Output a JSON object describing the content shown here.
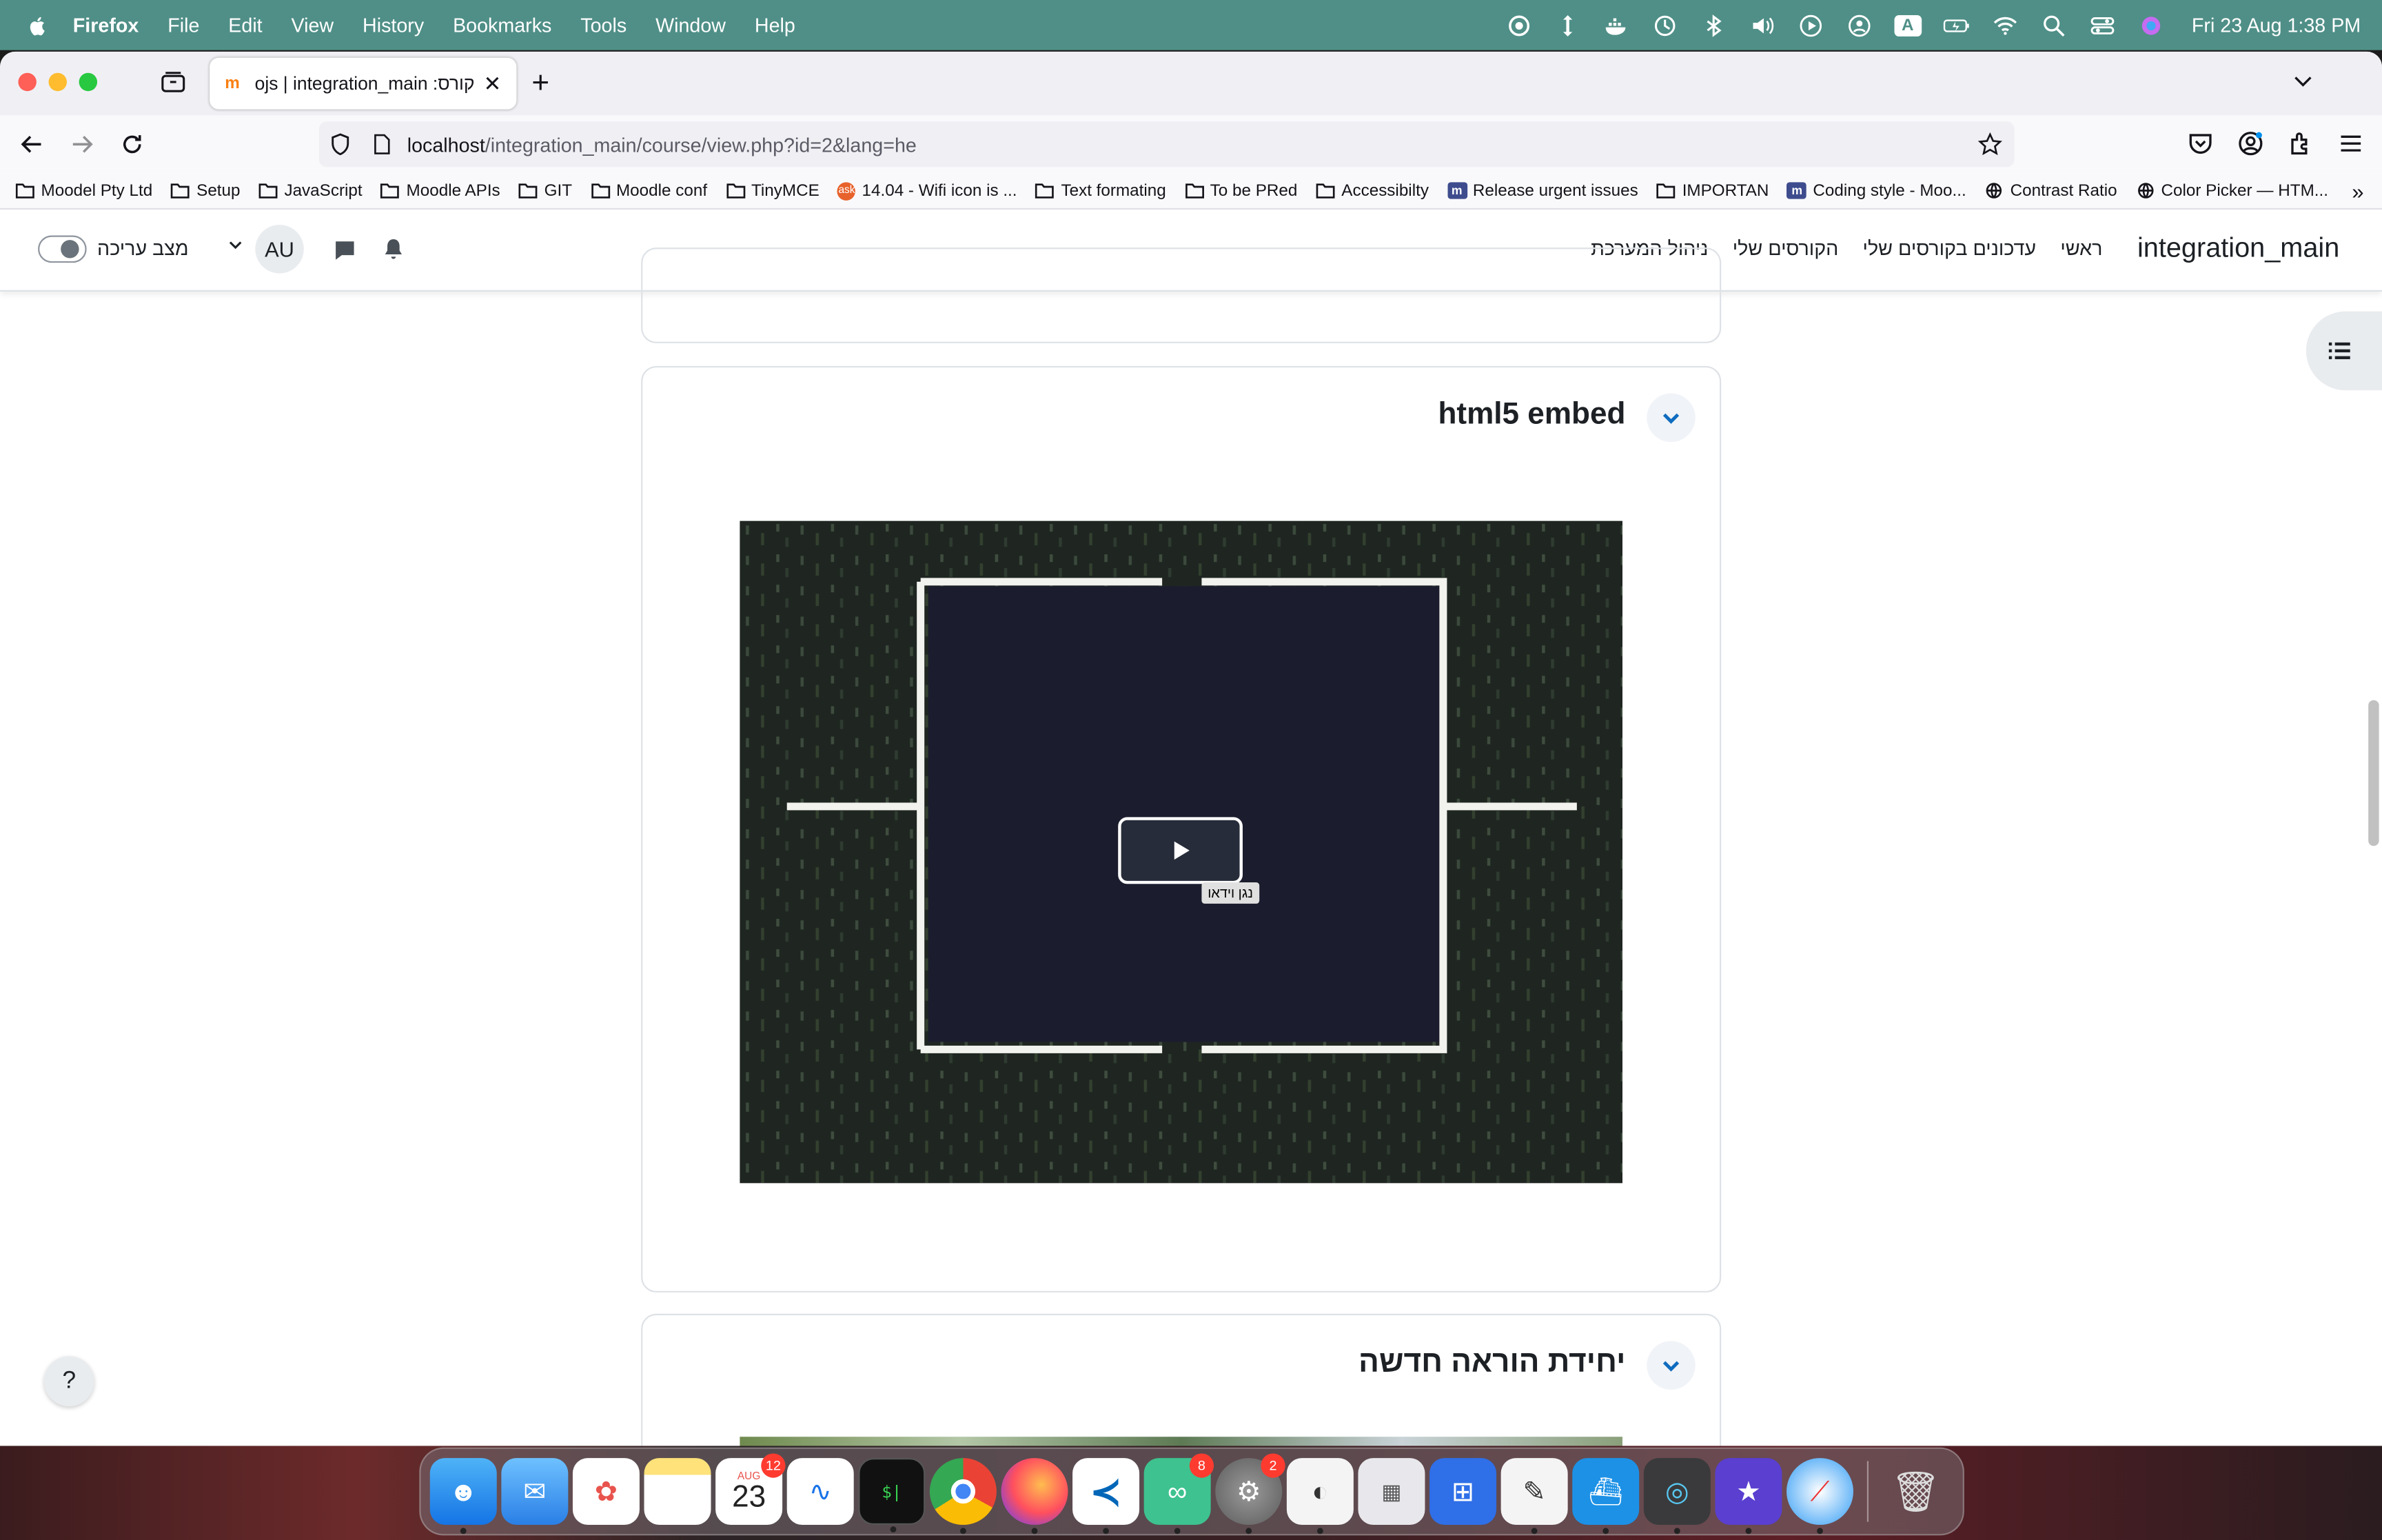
{
  "menubar": {
    "app_name": "Firefox",
    "items": [
      "File",
      "Edit",
      "View",
      "History",
      "Bookmarks",
      "Tools",
      "Window",
      "Help"
    ],
    "input_source": "A",
    "clock": "Fri 23 Aug  1:38 PM"
  },
  "browser": {
    "tab_title": "קורס: videojs | integration_main",
    "tab_favicon": "m",
    "url_host": "localhost",
    "url_path": "/integration_main/course/view.php?id=2&lang=he",
    "bookmarks": [
      {
        "label": "Moodel Pty Ltd",
        "icon": "folder-icon"
      },
      {
        "label": "Setup",
        "icon": "folder-icon"
      },
      {
        "label": "JavaScript",
        "icon": "folder-icon"
      },
      {
        "label": "Moodle APIs",
        "icon": "folder-icon"
      },
      {
        "label": "GIT",
        "icon": "folder-icon"
      },
      {
        "label": "Moodle conf",
        "icon": "folder-icon"
      },
      {
        "label": "TinyMCE",
        "icon": "folder-icon"
      },
      {
        "label": "14.04 - Wifi icon is ...",
        "icon": "askubuntu-icon"
      },
      {
        "label": "Text formating",
        "icon": "folder-icon"
      },
      {
        "label": "To be PRed",
        "icon": "folder-icon"
      },
      {
        "label": "Accessibilty",
        "icon": "folder-icon"
      },
      {
        "label": "Release urgent issues",
        "icon": "moodle-tracker-icon"
      },
      {
        "label": "IMPORTAN",
        "icon": "folder-icon"
      },
      {
        "label": "Coding style - Moo...",
        "icon": "moodle-tracker-icon"
      },
      {
        "label": "Contrast Ratio",
        "icon": "globe-icon"
      },
      {
        "label": "Color Picker — HTM...",
        "icon": "globe-icon"
      }
    ]
  },
  "moodle": {
    "site_name": "integration_main",
    "nav": [
      "ראשי",
      "עדכונים בקורסים שלי",
      "הקורסים שלי",
      "ניהול המערכת"
    ],
    "user_initials": "AU",
    "edit_mode_label": "מצב עריכה",
    "section1": {
      "title": "html5 embed",
      "video_tooltip": "נגן וידאו"
    },
    "section2": {
      "title": "יחידת הוראה חדשה"
    },
    "help_label": "?"
  },
  "dock": {
    "calendar_month": "AUG",
    "calendar_day": "23",
    "calendar_badge": "12",
    "messages_badge": "8",
    "settings_badge": "2",
    "terminal_prompt": "$|"
  },
  "colors": {
    "menubar_bg": "#4f8f87",
    "moodle_primary": "#0f6cbf"
  }
}
